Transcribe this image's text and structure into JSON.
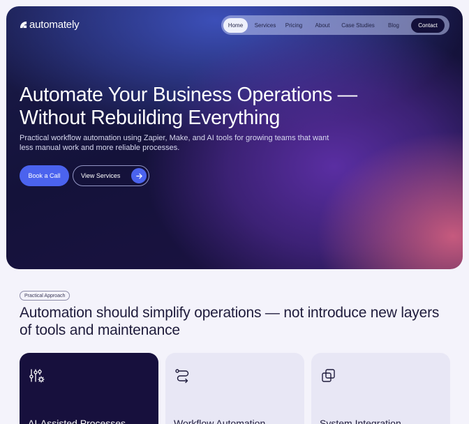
{
  "brand": {
    "name": "automately"
  },
  "nav": {
    "items": [
      "Home",
      "Services",
      "Pricing",
      "About",
      "Case Studies",
      "Blog"
    ],
    "contact": "Contact"
  },
  "hero": {
    "title": "Automate Your Business Operations — Without Rebuilding Everything",
    "subtitle": "Practical workflow automation using Zapier, Make, and AI tools for growing teams that want less manual work and more reliable processes.",
    "primary_button": "Book a Call",
    "secondary_button": "View Services"
  },
  "section": {
    "badge": "Practical Approach",
    "title": "Automation should simplify operations — not introduce new layers of tools and maintenance"
  },
  "cards": [
    {
      "title": "AI-Assisted Processes",
      "icon": "sliders-gear-icon"
    },
    {
      "title": "Workflow Automation",
      "icon": "workflow-route-icon"
    },
    {
      "title": "System Integration",
      "icon": "stacked-squares-icon"
    }
  ],
  "colors": {
    "accent": "#4b63ee",
    "dark_navy": "#13103a",
    "page_bg": "#f4f3fb",
    "card_bg": "#e8e7f5"
  }
}
